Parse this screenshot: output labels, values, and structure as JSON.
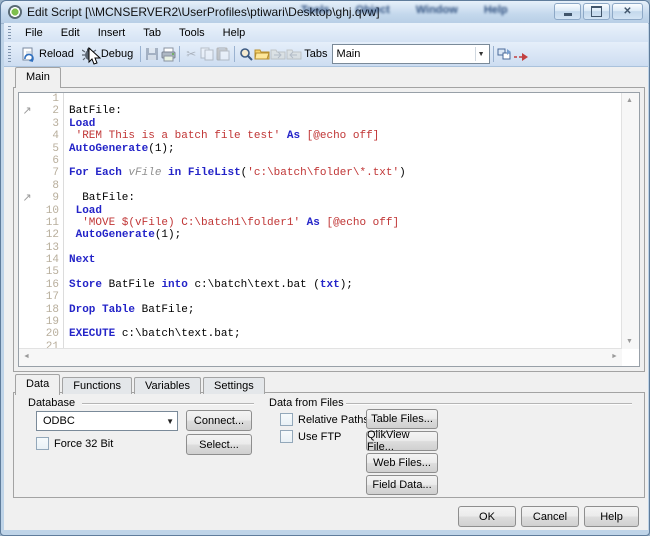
{
  "window": {
    "title": "Edit Script [\\\\MCNSERVER2\\UserProfiles\\ptiwari\\Desktop\\ghj.qvw]",
    "caption_buttons": [
      "minimize",
      "maximize",
      "close"
    ]
  },
  "background_window": {
    "menu_items": [
      "Tools",
      "Object",
      "Window",
      "Help"
    ]
  },
  "menu": {
    "items": [
      "File",
      "Edit",
      "Insert",
      "Tab",
      "Tools",
      "Help"
    ]
  },
  "toolbar": {
    "reload_label": "Reload",
    "debug_label": "Debug",
    "tabs_label": "Tabs",
    "tab_selector_value": "Main",
    "icon_names": [
      "reload-icon",
      "debug-icon",
      "save-icon",
      "print-icon",
      "cut-icon",
      "copy-icon",
      "paste-icon",
      "find-icon",
      "open-folder-icon",
      "export-tab-icon",
      "import-tab-icon",
      "merge-tab-icon",
      "promote-tab-icon"
    ]
  },
  "script_tabs": {
    "items": [
      "Main"
    ],
    "active_index": 0
  },
  "editor": {
    "lines": [
      {
        "n": 1,
        "t": []
      },
      {
        "n": 2,
        "m": 1,
        "t": [
          [
            "p",
            "BatFile:"
          ]
        ]
      },
      {
        "n": 3,
        "t": [
          [
            "k",
            "Load"
          ]
        ]
      },
      {
        "n": 4,
        "t": [
          [
            "p",
            " "
          ],
          [
            "s",
            "'REM This is a batch file test'"
          ],
          [
            "p",
            " "
          ],
          [
            "k",
            "As"
          ],
          [
            "p",
            " "
          ],
          [
            "s",
            "[@echo off]"
          ]
        ]
      },
      {
        "n": 5,
        "t": [
          [
            "k",
            "AutoGenerate"
          ],
          [
            "p",
            "(1);"
          ]
        ]
      },
      {
        "n": 6,
        "t": []
      },
      {
        "n": 7,
        "t": [
          [
            "k",
            "For Each"
          ],
          [
            "p",
            " "
          ],
          [
            "v",
            "vFile"
          ],
          [
            "p",
            " "
          ],
          [
            "k",
            "in"
          ],
          [
            "p",
            " "
          ],
          [
            "k",
            "FileList"
          ],
          [
            "p",
            "("
          ],
          [
            "s",
            "'c:\\batch\\folder\\*.txt'"
          ],
          [
            "p",
            ")"
          ]
        ]
      },
      {
        "n": 8,
        "t": []
      },
      {
        "n": 9,
        "m": 1,
        "t": [
          [
            "p",
            "  BatFile:"
          ]
        ]
      },
      {
        "n": 10,
        "t": [
          [
            "p",
            " "
          ],
          [
            "k",
            "Load"
          ]
        ]
      },
      {
        "n": 11,
        "t": [
          [
            "p",
            "  "
          ],
          [
            "s",
            "'MOVE $(vFile) C:\\batch1\\folder1'"
          ],
          [
            "p",
            " "
          ],
          [
            "k",
            "As"
          ],
          [
            "p",
            " "
          ],
          [
            "s",
            "[@echo off]"
          ]
        ]
      },
      {
        "n": 12,
        "t": [
          [
            "p",
            " "
          ],
          [
            "k",
            "AutoGenerate"
          ],
          [
            "p",
            "(1);"
          ]
        ]
      },
      {
        "n": 13,
        "t": []
      },
      {
        "n": 14,
        "t": [
          [
            "k",
            "Next"
          ]
        ]
      },
      {
        "n": 15,
        "t": []
      },
      {
        "n": 16,
        "t": [
          [
            "k",
            "Store"
          ],
          [
            "p",
            " BatFile "
          ],
          [
            "k",
            "into"
          ],
          [
            "p",
            " c:\\batch\\text.bat ("
          ],
          [
            "k",
            "txt"
          ],
          [
            "p",
            ");"
          ]
        ]
      },
      {
        "n": 17,
        "t": []
      },
      {
        "n": 18,
        "t": [
          [
            "k",
            "Drop Table"
          ],
          [
            "p",
            " BatFile;"
          ]
        ]
      },
      {
        "n": 19,
        "t": []
      },
      {
        "n": 20,
        "t": [
          [
            "k",
            "EXECUTE"
          ],
          [
            "p",
            " c:\\batch\\text.bat;"
          ]
        ]
      },
      {
        "n": 21,
        "t": []
      }
    ]
  },
  "bottom_tabs": {
    "items": [
      "Data",
      "Functions",
      "Variables",
      "Settings"
    ],
    "active_index": 0
  },
  "data_tab": {
    "database": {
      "label": "Database",
      "combo_value": "ODBC",
      "connect_label": "Connect...",
      "select_label": "Select...",
      "force32_label": "Force 32 Bit",
      "force32_checked": false
    },
    "files": {
      "label": "Data from Files",
      "relative_paths_label": "Relative Paths",
      "relative_paths_checked": false,
      "use_ftp_label": "Use FTP",
      "use_ftp_checked": false,
      "buttons": [
        "Table Files...",
        "QlikView File...",
        "Web Files...",
        "Field Data..."
      ]
    }
  },
  "footer": {
    "ok": "OK",
    "cancel": "Cancel",
    "help": "Help"
  },
  "colors": {
    "keyword": "#2424c8",
    "string": "#c03535",
    "variable": "#8f8f8f",
    "line_number": "#b8ae9c",
    "titlebar": "#c4d8ec",
    "toolbar": "#d9e6f5",
    "panel_bg": "#f0f0f0"
  }
}
